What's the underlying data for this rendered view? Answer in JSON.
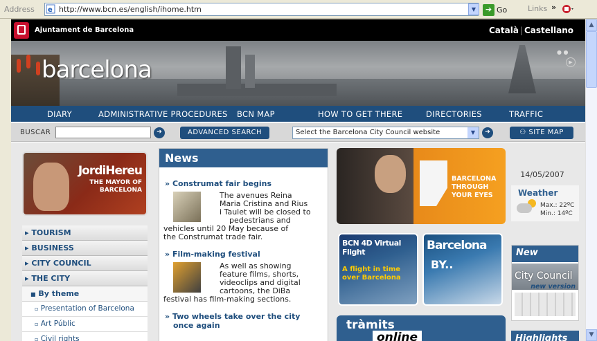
{
  "browser": {
    "address_label": "Address",
    "url": "http://www.bcn.es/english/ihome.htm",
    "go_label": "Go",
    "links_label": "Links"
  },
  "header": {
    "org_name": "Ajuntament de Barcelona",
    "lang_catala": "Català",
    "lang_castellano": "Castellano",
    "banner_title": "barcelona"
  },
  "nav": {
    "items": [
      "DIARY",
      "ADMINISTRATIVE PROCEDURES",
      "BCN MAP",
      "HOW TO GET THERE",
      "DIRECTORIES",
      "TRAFFIC"
    ]
  },
  "search": {
    "label": "BUSCAR",
    "value": "",
    "advanced_label": "ADVANCED SEARCH",
    "select_value": "Select the Barcelona City Council website",
    "sitemap_label": "SITE MAP"
  },
  "mayor": {
    "name": "JordiHereu",
    "line1": "THE MAYOR OF",
    "line2": "BARCELONA"
  },
  "left_menu": {
    "main": [
      "TOURISM",
      "BUSINESS",
      "CITY COUNCIL",
      "THE CITY"
    ],
    "sub": "By theme",
    "items": [
      "Presentation of Barcelona",
      "Art Públic",
      "Civil rights"
    ]
  },
  "news": {
    "heading": "News",
    "items": [
      {
        "title": "Construmat fair begins",
        "text_lines": [
          "The avenues Reina",
          "Maria Cristina and Rius",
          "i Taulet will be closed to",
          "pedestrians and",
          "vehicles until 20 May because of",
          "the Construmat trade fair."
        ]
      },
      {
        "title": "Film-making festival",
        "text_lines": [
          "As well as showing",
          "feature films, shorts,",
          "videoclips and digital",
          "cartoons, the DiBa",
          "festival has film-making sections."
        ]
      },
      {
        "title_lines": [
          "Two wheels take over the city",
          "once again"
        ]
      }
    ]
  },
  "promos": {
    "bcn_line1": "BARCELONA",
    "bcn_line2": "THROUGH",
    "bcn_line3": "YOUR EYES",
    "flight_title": "BCN 4D Virtual Flight",
    "flight_line1": "A flight in time",
    "flight_line2": "over Barcelona",
    "by_title": "Barcelona",
    "by_sub": "BY..",
    "tramits_t": "tràmits",
    "tramits_o": "online"
  },
  "sidebar_right": {
    "date": "14/05/2007",
    "weather_title": "Weather",
    "weather_max": "Max.: 22ºC",
    "weather_min": "Min.: 14ºC",
    "new_heading": "New",
    "city_council": "City Council",
    "new_version": "new version",
    "highlights": "Highlights"
  }
}
